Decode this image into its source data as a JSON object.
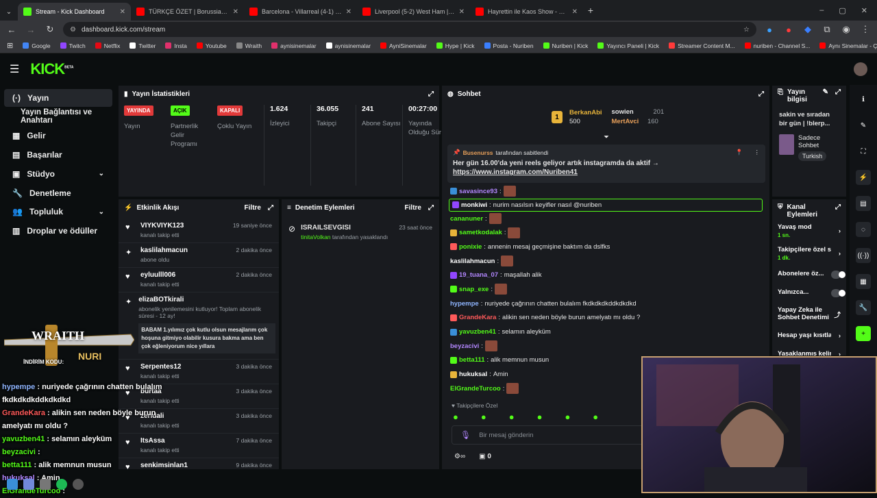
{
  "browser": {
    "tabs": [
      {
        "label": "Stream - Kick Dashboard",
        "active": true,
        "color": "#53fc18"
      },
      {
        "label": "TÜRKÇE ÖZET | Borussia Dortm",
        "active": false,
        "color": "#ff0000"
      },
      {
        "label": "Barcelona - Villarreal (4-1) - Ma",
        "active": false,
        "color": "#ff0000"
      },
      {
        "label": "Liverpool (5-2) West Ham | 28.",
        "active": false,
        "color": "#ff0000"
      },
      {
        "label": "Hayrettin ile Kaos Show - 2.Sez",
        "active": false,
        "color": "#ff0000"
      }
    ],
    "url": "dashboard.kick.com/stream",
    "bookmarks": [
      "Google",
      "Twitch",
      "Netflix",
      "Twitter",
      "Insta",
      "Youtube",
      "Wraith",
      "aynisinemalar",
      "aynisinemalar",
      "AyniSinemalar",
      "Hype | Kick",
      "Posta - Nuriben",
      "Nuriben | Kick",
      "Yayıncı Paneli | Kick",
      "Streamer Content M...",
      "nuriben - Channel S...",
      "Aynı Sinemalar - Ça..."
    ]
  },
  "brand": {
    "logo": "KICK",
    "logo_sup": "BETA",
    "accent": "#53fc18"
  },
  "sidebar": {
    "items": [
      {
        "label": "Yayın",
        "icon": "broadcast-icon",
        "active": true
      },
      {
        "label": "Yayın Bağlantısı ve Anahtarı",
        "icon": "",
        "active": false
      },
      {
        "label": "Gelir",
        "icon": "revenue-icon",
        "active": false
      },
      {
        "label": "Başarılar",
        "icon": "achievements-icon",
        "active": false
      },
      {
        "label": "Stüdyo",
        "icon": "studio-icon",
        "active": false,
        "expand": true
      },
      {
        "label": "Denetleme",
        "icon": "wrench-icon",
        "active": false
      },
      {
        "label": "Topluluk",
        "icon": "community-icon",
        "active": false,
        "expand": true
      },
      {
        "label": "Droplar ve ödüller",
        "icon": "drops-icon",
        "active": false
      }
    ]
  },
  "stats": {
    "title": "Yayın İstatistikleri",
    "cells": [
      {
        "badge": "YAYINDA",
        "badge_color": "#e23a3a",
        "label": "Yayın"
      },
      {
        "badge": "AÇIK",
        "badge_color": "#53fc18",
        "label": "Partnerlik Gelir Programı"
      },
      {
        "badge": "KAPALI",
        "badge_color": "#e23a3a",
        "label": "Çoklu Yayın"
      },
      {
        "value": "1.624",
        "label": "İzleyici"
      },
      {
        "value": "36.055",
        "label": "Takipçi"
      },
      {
        "value": "241",
        "label": "Abone Sayısı"
      },
      {
        "value": "00:27:00",
        "label": "Yayında Olduğu Süre"
      }
    ]
  },
  "activity": {
    "title": "Etkinlik Akışı",
    "filter": "Filtre",
    "events": [
      {
        "name": "VIYKVIYK123",
        "sub": "kanalı takip etti",
        "time": "19 saniye önce",
        "icon": "heart-icon"
      },
      {
        "name": "kaslilahmacun",
        "sub": "abone oldu",
        "time": "2 dakika önce",
        "icon": "sparkle-icon"
      },
      {
        "name": "eyluulll006",
        "sub": "kanalı takip etti",
        "time": "2 dakika önce",
        "icon": "heart-icon"
      },
      {
        "name": "elizaBOTkirali",
        "sub": "abonelik yenilemesini kutluyor! Toplam abonelik süresi - 12 ay!",
        "time": "3 dakika önce",
        "icon": "sparkle-icon"
      },
      {
        "name": "Serpentes12",
        "sub": "kanalı takip etti",
        "time": "3 dakika önce",
        "icon": "heart-icon"
      },
      {
        "name": "burtaa",
        "sub": "kanalı takip etti",
        "time": "3 dakika önce",
        "icon": "heart-icon"
      },
      {
        "name": "zeridali",
        "sub": "kanalı takip etti",
        "time": "3 dakika önce",
        "icon": "heart-icon"
      },
      {
        "name": "ItsAssa",
        "sub": "kanalı takip etti",
        "time": "7 dakika önce",
        "icon": "heart-icon"
      },
      {
        "name": "senkimsinlan1",
        "sub": "",
        "time": "9 dakika önce",
        "icon": "heart-icon"
      }
    ],
    "sub_message": "BABAM 1.yılımız çok kutlu olsun mesajlarım çok hoşuna gitmiyo olabilir kusura bakma ama ben çok eğleniyorum nice yıllara"
  },
  "moderation": {
    "title": "Denetim Eylemleri",
    "filter": "Filtre",
    "items": [
      {
        "name": "ISRAILSEVGISI",
        "by": "tinitaVolkan",
        "action": "tarafından yasaklandı",
        "time": "23 saat önce"
      }
    ]
  },
  "chat": {
    "title": "Sohbet",
    "leaders": [
      {
        "rank": "1",
        "name": "BerkanAbi",
        "amount": "500"
      },
      {
        "name": "sowien",
        "amount": "201"
      },
      {
        "name": "MertAvci",
        "amount": "160"
      }
    ],
    "pinned": {
      "by": "Busenurss",
      "by_suffix": "tarafından sabitlendi",
      "text": "Her gün 16.00'da yeni reels geliyor artık instagramda da aktif →",
      "link": "https://www.instagram.com/Nuriben41"
    },
    "messages": [
      {
        "user": "savasince93",
        "color": "#b387ff",
        "text": "",
        "emote": true
      },
      {
        "user": "monkiwi",
        "color": "#ffffff",
        "text": "nurim nasılsın keyifler nasıl @nuriben",
        "highlight": true
      },
      {
        "user": "cananuner",
        "color": "#53fc18",
        "text": "",
        "emote": true
      },
      {
        "user": "sametkodalak",
        "color": "#53fc18",
        "text": "",
        "emote": true
      },
      {
        "user": "ponixie",
        "color": "#53fc18",
        "text": "annenin mesaj geçmişine baktım da dslfks"
      },
      {
        "user": "kaslilahmacun",
        "color": "#ffffff",
        "text": "",
        "emote": true
      },
      {
        "user": "19_tuana_07",
        "color": "#b387ff",
        "text": "maşallah alik"
      },
      {
        "user": "snap_exe",
        "color": "#53fc18",
        "text": "",
        "emote": true
      },
      {
        "user": "hypempe",
        "color": "#8fb5ff",
        "text": "nuriyede çağrının chatten bulalım fkdkdkdkddkdkdkd"
      },
      {
        "user": "GrandeKara",
        "color": "#ff5a5a",
        "text": "alikin sen neden böyle burun amelyatı mı oldu ?"
      },
      {
        "user": "yavuzben41",
        "color": "#53fc18",
        "text": "selamın aleyküm"
      },
      {
        "user": "beyzacivi",
        "color": "#b387ff",
        "text": "",
        "emote": true
      },
      {
        "user": "betta111",
        "color": "#53fc18",
        "text": "alik memnun musun"
      },
      {
        "user": "hukuksal",
        "color": "#ffffff",
        "text": "Amin"
      },
      {
        "user": "ElGrandeTurcoo",
        "color": "#53fc18",
        "text": "",
        "emote": true
      }
    ],
    "mode": "Takipçilere Özel",
    "input_placeholder": "Bir mesaj gönderin",
    "points": "0"
  },
  "stream_info": {
    "title": "Yayın bilgisi",
    "stream_title": "sakin ve sıradan bir gün | !blerp...",
    "category": "Sadece Sohbet",
    "language": "Turkish"
  },
  "channel_actions": {
    "title": "Kanal Eylemleri",
    "rows": [
      {
        "label": "Yavaş mod",
        "sub": "1 sn.",
        "type": "arrow"
      },
      {
        "label": "Takipçilere özel s",
        "sub": "1 dk.",
        "type": "arrow"
      },
      {
        "label": "Abonelere öz...",
        "type": "toggle"
      },
      {
        "label": "Yalnızca...",
        "type": "toggle"
      },
      {
        "label": "Yapay Zeka ile Sohbet Denetimi",
        "type": "link"
      },
      {
        "label": "Hesap yaşı kısıtla",
        "type": "arrow"
      },
      {
        "label": "Yasaklanmış kelin",
        "type": "arrow"
      }
    ]
  },
  "overlay": {
    "sponsor": "WRAITH",
    "code_label": "İNDİRİM KODU:",
    "code": "NURI",
    "chat": [
      {
        "user": "hypempe",
        "color": "#8fb5ff",
        "text": "nuriyede çağrının chatten bulalım fkdkdkdkddkdkdkd"
      },
      {
        "user": "GrandeKara",
        "color": "#ff5a5a",
        "text": "alikin sen neden böyle burun amelyatı mı oldu ?"
      },
      {
        "user": "yavuzben41",
        "color": "#53fc18",
        "text": "selamın aleyküm"
      },
      {
        "user": "beyzacivi",
        "color": "#53fc18",
        "text": ""
      },
      {
        "user": "betta111",
        "color": "#53fc18",
        "text": "alik memnun musun"
      },
      {
        "user": "hukuksal",
        "color": "#b387ff",
        "text": "Amin"
      },
      {
        "user": "ElGrandeTurcoo",
        "color": "#53fc18",
        "text": ""
      }
    ]
  }
}
